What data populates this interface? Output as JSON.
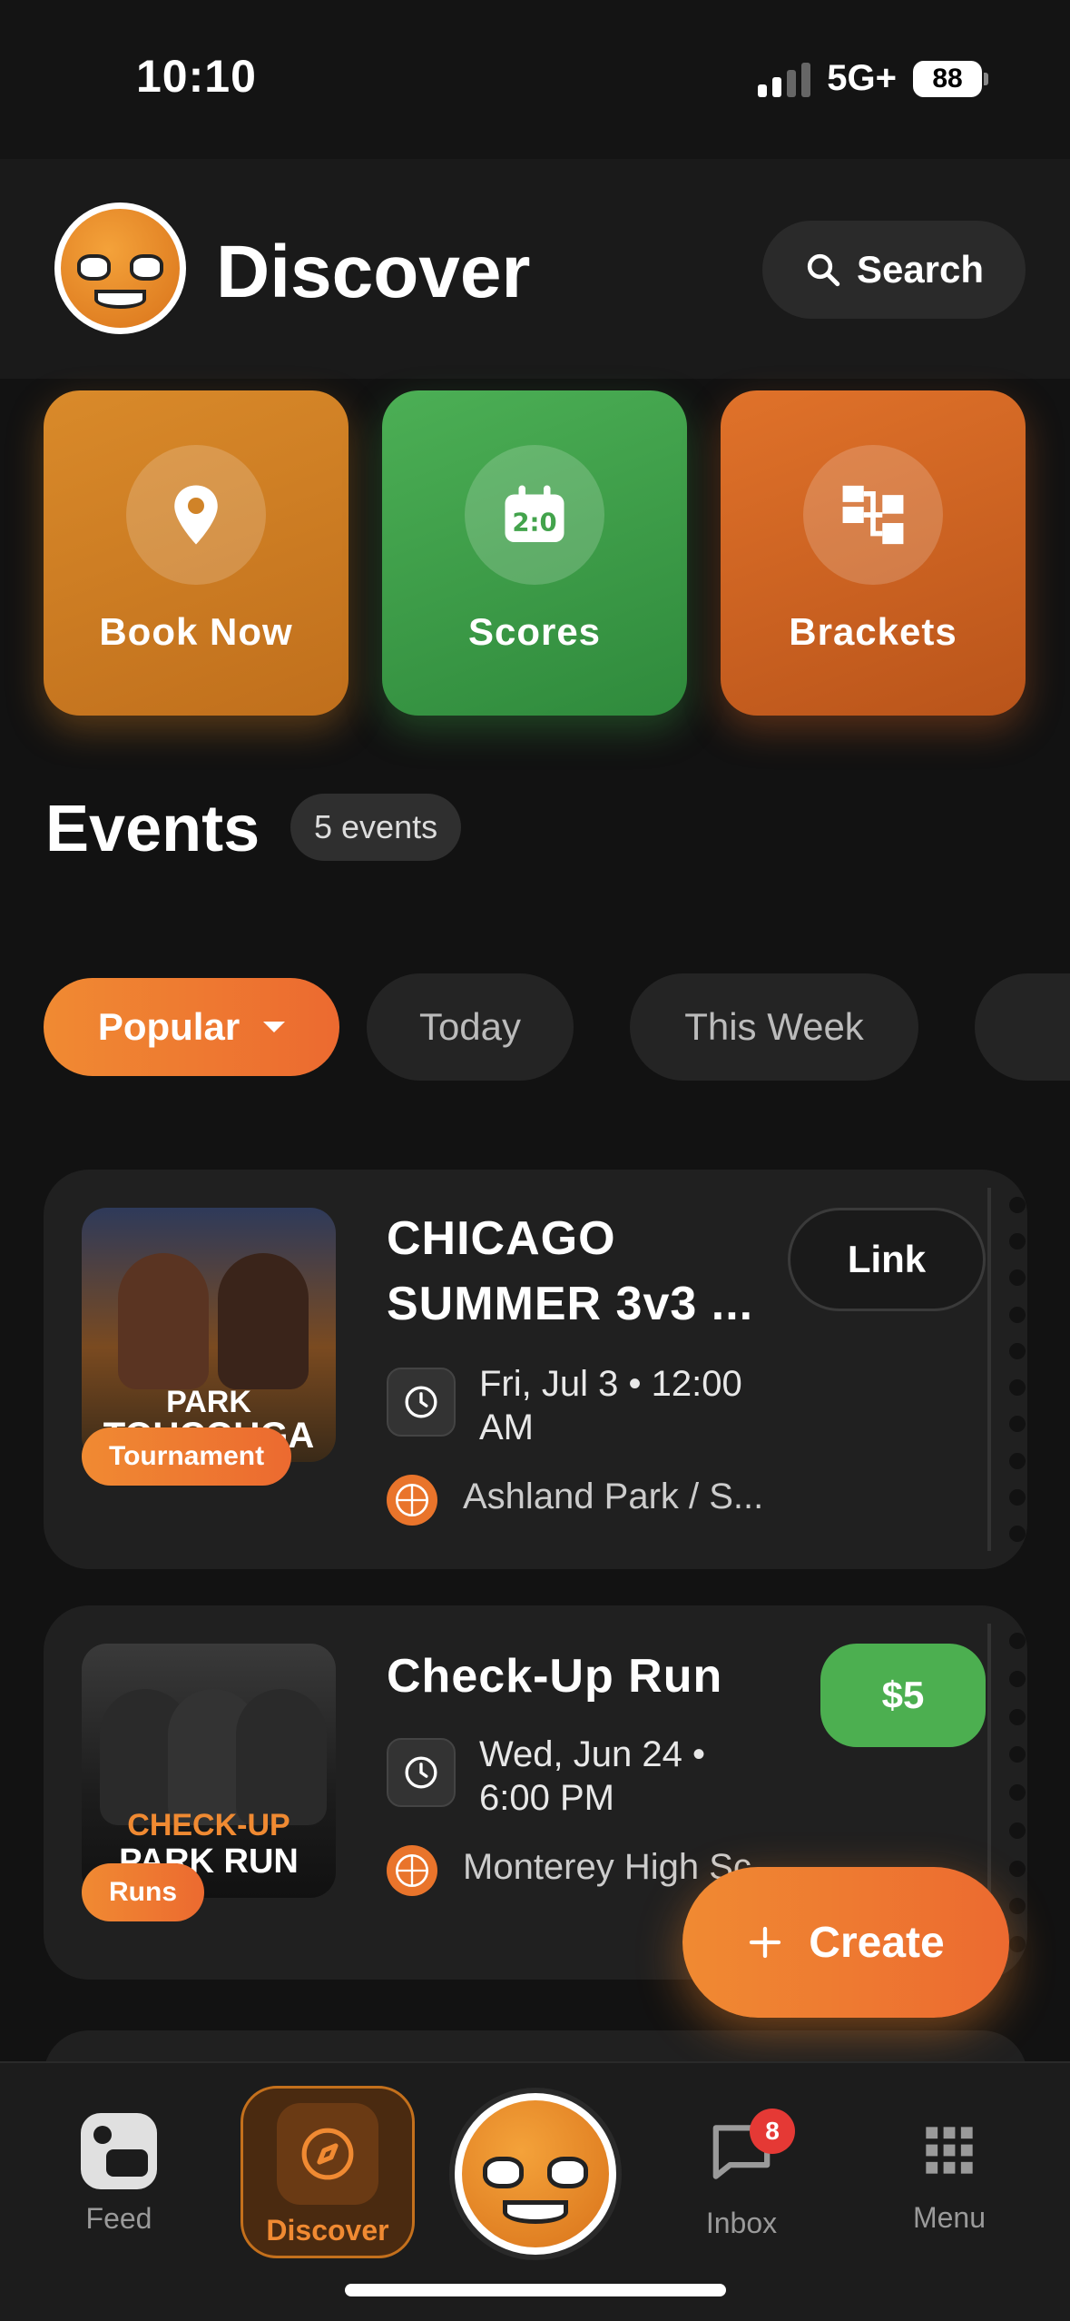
{
  "status_bar": {
    "time": "10:10",
    "network": "5G+",
    "battery": "88"
  },
  "header": {
    "title": "Discover",
    "search_label": "Search"
  },
  "quick_actions": [
    {
      "label": "Book Now",
      "icon": "location-pin-icon",
      "color": "#d98a2a"
    },
    {
      "label": "Scores",
      "icon": "scoreboard-icon",
      "color": "#4caf55"
    },
    {
      "label": "Brackets",
      "icon": "bracket-icon",
      "color": "#e0722a"
    }
  ],
  "events": {
    "title": "Events",
    "count_label": "5 events",
    "filters": [
      {
        "label": "Popular",
        "active": true
      },
      {
        "label": "Today",
        "active": false
      },
      {
        "label": "This Week",
        "active": false
      },
      {
        "label": "",
        "active": false
      }
    ],
    "items": [
      {
        "title_line1": "CHICAGO",
        "title_line2": "SUMMER 3v3 ...",
        "badge": "Tournament",
        "when_line1": "Fri, Jul 3 • 12:00",
        "when_line2": "AM",
        "where": "Ashland Park / S...",
        "action": "Link",
        "poster_text_1": "PARK",
        "poster_text_2": "TOUCOUGA"
      },
      {
        "title_line1": "Check-Up Run",
        "badge": "Runs",
        "when_line1": "Wed, Jun 24 •",
        "when_line2": "6:00 PM",
        "where": "Monterey High Sc...",
        "action": "$5",
        "poster_text_1": "CHECK-UP",
        "poster_text_2": "PARK RUN"
      }
    ]
  },
  "create_button": {
    "label": "Create"
  },
  "bottom_nav": {
    "feed": "Feed",
    "discover": "Discover",
    "inbox": "Inbox",
    "inbox_badge": "8",
    "menu": "Menu"
  },
  "colors": {
    "accent": "#f08a32",
    "green": "#4caf50",
    "background": "#121212"
  }
}
